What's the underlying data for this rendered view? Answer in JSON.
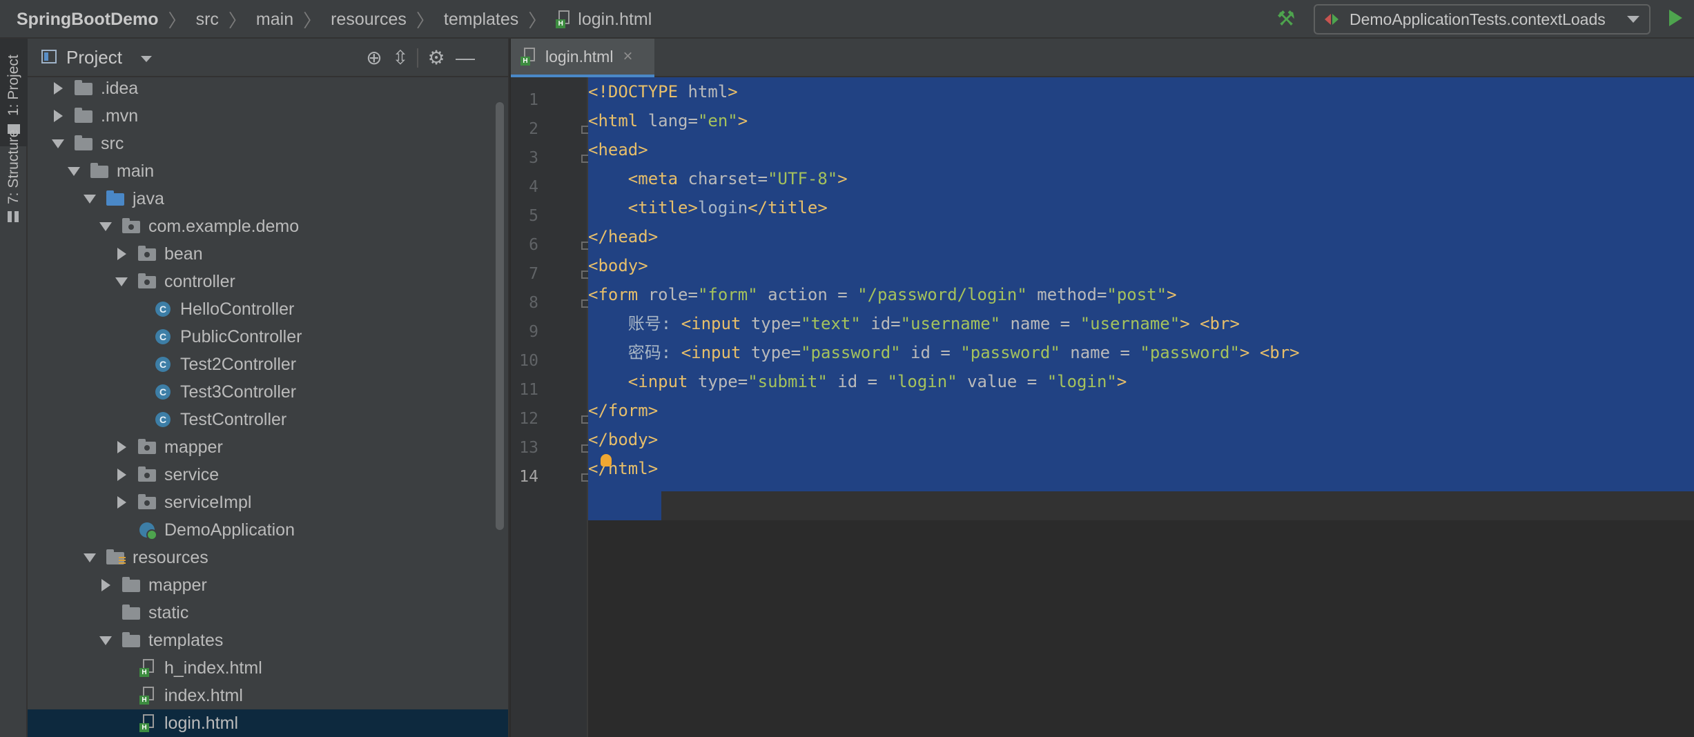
{
  "breadcrumb": {
    "project": "SpringBootDemo",
    "segments": [
      "src",
      "main",
      "resources",
      "templates"
    ],
    "file": "login.html"
  },
  "run_config": {
    "label": "DemoApplicationTests.contextLoads"
  },
  "tool_strip": {
    "project_tab": "1: Project",
    "structure_tab": "7: Structure"
  },
  "project_panel": {
    "title": "Project",
    "tree": [
      {
        "label": ".idea",
        "depth": 1,
        "state": "collapsed",
        "icon": "folder"
      },
      {
        "label": ".mvn",
        "depth": 1,
        "state": "collapsed",
        "icon": "folder"
      },
      {
        "label": "src",
        "depth": 1,
        "state": "expanded",
        "icon": "folder"
      },
      {
        "label": "main",
        "depth": 2,
        "state": "expanded",
        "icon": "folder"
      },
      {
        "label": "java",
        "depth": 3,
        "state": "expanded",
        "icon": "source-folder"
      },
      {
        "label": "com.example.demo",
        "depth": 4,
        "state": "expanded",
        "icon": "package"
      },
      {
        "label": "bean",
        "depth": 5,
        "state": "collapsed",
        "icon": "package"
      },
      {
        "label": "controller",
        "depth": 5,
        "state": "expanded",
        "icon": "package"
      },
      {
        "label": "HelloController",
        "depth": 6,
        "state": "leaf",
        "icon": "class"
      },
      {
        "label": "PublicController",
        "depth": 6,
        "state": "leaf",
        "icon": "class"
      },
      {
        "label": "Test2Controller",
        "depth": 6,
        "state": "leaf",
        "icon": "class"
      },
      {
        "label": "Test3Controller",
        "depth": 6,
        "state": "leaf",
        "icon": "class"
      },
      {
        "label": "TestController",
        "depth": 6,
        "state": "leaf",
        "icon": "class"
      },
      {
        "label": "mapper",
        "depth": 5,
        "state": "collapsed",
        "icon": "package"
      },
      {
        "label": "service",
        "depth": 5,
        "state": "collapsed",
        "icon": "package"
      },
      {
        "label": "serviceImpl",
        "depth": 5,
        "state": "collapsed",
        "icon": "package"
      },
      {
        "label": "DemoApplication",
        "depth": 5,
        "state": "leaf",
        "icon": "spring-boot"
      },
      {
        "label": "resources",
        "depth": 3,
        "state": "expanded",
        "icon": "resources-folder"
      },
      {
        "label": "mapper",
        "depth": 4,
        "state": "collapsed",
        "icon": "folder"
      },
      {
        "label": "static",
        "depth": 4,
        "state": "leaf",
        "icon": "folder"
      },
      {
        "label": "templates",
        "depth": 4,
        "state": "expanded",
        "icon": "folder"
      },
      {
        "label": "h_index.html",
        "depth": 5,
        "state": "leaf",
        "icon": "html"
      },
      {
        "label": "index.html",
        "depth": 5,
        "state": "leaf",
        "icon": "html"
      },
      {
        "label": "login.html",
        "depth": 5,
        "state": "leaf",
        "icon": "html",
        "selected": true
      }
    ]
  },
  "editor": {
    "tab_label": "login.html",
    "close_glyph": "×",
    "current_line": 14,
    "lines": [
      [
        [
          "tg",
          "<!DOCTYPE "
        ],
        [
          "at",
          "html"
        ],
        [
          "tg",
          ">"
        ]
      ],
      [
        [
          "tg",
          "<html "
        ],
        [
          "at",
          "lang="
        ],
        [
          "av",
          "\"en\""
        ],
        [
          "tg",
          ">"
        ]
      ],
      [
        [
          "tg",
          "<head>"
        ]
      ],
      [
        [
          "tx",
          "    "
        ],
        [
          "tg",
          "<meta "
        ],
        [
          "at",
          "charset="
        ],
        [
          "av",
          "\"UTF-8\""
        ],
        [
          "tg",
          ">"
        ]
      ],
      [
        [
          "tx",
          "    "
        ],
        [
          "tg",
          "<title>"
        ],
        [
          "tx",
          "login"
        ],
        [
          "tg",
          "</title>"
        ]
      ],
      [
        [
          "tg",
          "</head>"
        ]
      ],
      [
        [
          "tg",
          "<body>"
        ]
      ],
      [
        [
          "tg",
          "<form "
        ],
        [
          "at",
          "role="
        ],
        [
          "av",
          "\"form\""
        ],
        [
          "at",
          " action = "
        ],
        [
          "av",
          "\"/password/login\""
        ],
        [
          "at",
          " method="
        ],
        [
          "av",
          "\"post\""
        ],
        [
          "tg",
          ">"
        ]
      ],
      [
        [
          "tx",
          "    账号: "
        ],
        [
          "tg",
          "<input "
        ],
        [
          "at",
          "type="
        ],
        [
          "av",
          "\"text\""
        ],
        [
          "at",
          " id="
        ],
        [
          "av",
          "\"username\""
        ],
        [
          "at",
          " name = "
        ],
        [
          "av",
          "\"username\""
        ],
        [
          "tg",
          ">"
        ],
        [
          "tx",
          " "
        ],
        [
          "tg",
          "<br>"
        ]
      ],
      [
        [
          "tx",
          "    密码: "
        ],
        [
          "tg",
          "<input "
        ],
        [
          "at",
          "type="
        ],
        [
          "av",
          "\"password\""
        ],
        [
          "at",
          " id = "
        ],
        [
          "av",
          "\"password\""
        ],
        [
          "at",
          " name = "
        ],
        [
          "av",
          "\"password\""
        ],
        [
          "tg",
          ">"
        ],
        [
          "tx",
          " "
        ],
        [
          "tg",
          "<br>"
        ]
      ],
      [
        [
          "tx",
          "    "
        ],
        [
          "tg",
          "<input "
        ],
        [
          "at",
          "type="
        ],
        [
          "av",
          "\"submit\""
        ],
        [
          "at",
          " id = "
        ],
        [
          "av",
          "\"login\""
        ],
        [
          "at",
          " value = "
        ],
        [
          "av",
          "\"login\""
        ],
        [
          "tg",
          ">"
        ]
      ],
      [
        [
          "tg",
          "</form>"
        ]
      ],
      [
        [
          "tg",
          "</body>"
        ]
      ],
      [
        [
          "tg",
          "</html>"
        ]
      ]
    ]
  },
  "colors": {
    "tag": "#e8bf6a",
    "attribute": "#bababa",
    "attribute_value": "#a5c25c",
    "text": "#a9b7c6",
    "selection": "#214283",
    "tree_selection": "#0d293e",
    "accent": "#4a88c7"
  }
}
